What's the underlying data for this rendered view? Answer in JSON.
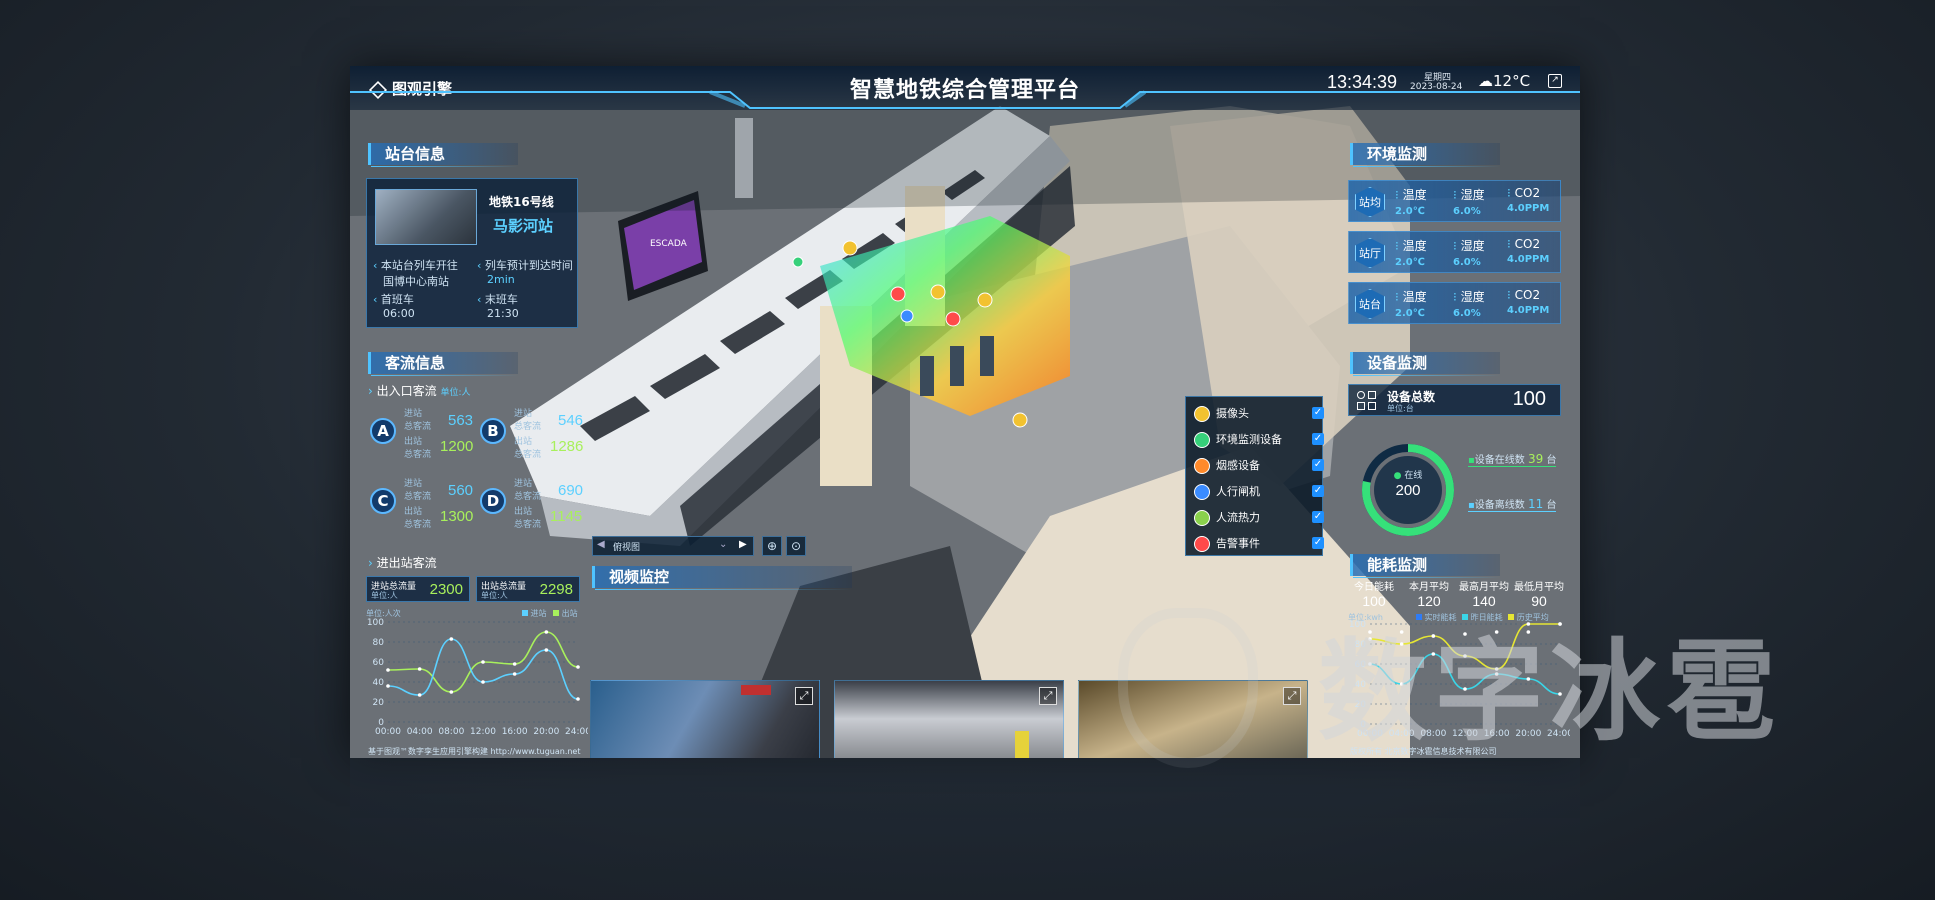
{
  "header": {
    "logo": "图观引擎",
    "title": "智慧地铁综合管理平台",
    "time": "13:34:39",
    "weekday": "星期四",
    "date": "2023-08-24",
    "weather": "12°C"
  },
  "station_info": {
    "title": "站台信息",
    "line": "地铁16号线",
    "station": "马影河站",
    "dir_label": "本站台列车开往",
    "dir_value": "国博中心南站",
    "eta_label": "列车预计到达时间",
    "eta_value": "2min",
    "first_label": "首班车",
    "first_value": "06:00",
    "last_label": "末班车",
    "last_value": "21:30"
  },
  "passenger": {
    "title": "客流信息",
    "gate_title": "出入口客流",
    "unit": "单位:人",
    "in_label": "进站",
    "out_label": "出站",
    "total_label": "总客流",
    "gates": [
      {
        "id": "A",
        "in": "563",
        "out": "1200"
      },
      {
        "id": "B",
        "in": "546",
        "out": "1286"
      },
      {
        "id": "C",
        "in": "560",
        "out": "1300"
      },
      {
        "id": "D",
        "in": "690",
        "out": "1145"
      }
    ],
    "flow_title": "进出站客流",
    "in_total_label": "进站总流量",
    "in_total": "2300",
    "out_total_label": "出站总流量",
    "out_total": "2298",
    "box_unit": "单位:人"
  },
  "flow_chart": {
    "unit": "单位:人次",
    "legend_in": "进站",
    "legend_out": "出站"
  },
  "chart_data": [
    {
      "type": "line",
      "title": "",
      "ylabel": "单位:人次",
      "x": [
        "00:00",
        "04:00",
        "08:00",
        "12:00",
        "16:00",
        "20:00",
        "24:00"
      ],
      "ylim": [
        0,
        100
      ],
      "yticks": [
        0,
        20,
        40,
        60,
        80,
        100
      ],
      "series": [
        {
          "name": "进站",
          "color": "#a8f05c",
          "values": [
            52,
            53,
            30,
            60,
            58,
            90,
            55
          ]
        },
        {
          "name": "出站",
          "color": "#5cd0ff",
          "values": [
            36,
            27,
            83,
            40,
            48,
            72,
            23
          ]
        }
      ]
    },
    {
      "type": "line",
      "title": "",
      "ylabel": "单位:kwh",
      "x": [
        "00:00",
        "04:00",
        "08:00",
        "12:00",
        "16:00",
        "20:00",
        "24:00"
      ],
      "ylim": [
        0,
        100
      ],
      "yticks": [
        0,
        20,
        40,
        60,
        80,
        100
      ],
      "series": [
        {
          "name": "实时能耗",
          "color": "#2f7cf6",
          "values": [
            92,
            92,
            88,
            90,
            92,
            92,
            100
          ]
        },
        {
          "name": "昨日能耗",
          "color": "#3ad6e8",
          "values": [
            60,
            40,
            70,
            35,
            50,
            45,
            30
          ]
        },
        {
          "name": "历史平均",
          "color": "#e6e633",
          "values": [
            85,
            80,
            88,
            68,
            55,
            100,
            100
          ]
        }
      ]
    }
  ],
  "video": {
    "title": "视频监控",
    "view_label": "俯视图"
  },
  "layers": [
    {
      "label": "摄像头",
      "icon": "camera-icon",
      "color": "#f2c230"
    },
    {
      "label": "环境监测设备",
      "icon": "env-sensor-icon",
      "color": "#36d07a"
    },
    {
      "label": "烟感设备",
      "icon": "smoke-sensor-icon",
      "color": "#ff8a2b"
    },
    {
      "label": "人行闸机",
      "icon": "gate-icon",
      "color": "#3b8cff"
    },
    {
      "label": "人流热力",
      "icon": "heatmap-icon",
      "color": "#8ad14c"
    },
    {
      "label": "告警事件",
      "icon": "alarm-icon",
      "color": "#ff4a4a"
    }
  ],
  "env": {
    "title": "环境监测",
    "rows": [
      {
        "badge": "站均",
        "temp_label": "温度",
        "temp": "2.0℃",
        "hum_label": "湿度",
        "hum": "6.0%",
        "co2_label": "CO2",
        "co2": "4.0PPM"
      },
      {
        "badge": "站厅",
        "temp_label": "温度",
        "temp": "2.0℃",
        "hum_label": "湿度",
        "hum": "6.0%",
        "co2_label": "CO2",
        "co2": "4.0PPM"
      },
      {
        "badge": "站台",
        "temp_label": "温度",
        "temp": "2.0℃",
        "hum_label": "湿度",
        "hum": "6.0%",
        "co2_label": "CO2",
        "co2": "4.0PPM"
      }
    ]
  },
  "device": {
    "title": "设备监测",
    "total_label": "设备总数",
    "unit": "单位:台",
    "total": "100",
    "ring_label": "在线",
    "ring_value": "200",
    "online_label": "设备在线数",
    "online_value": "39",
    "offline_label": "设备离线数",
    "offline_value": "11",
    "unit_tai": "台",
    "online_ratio": 0.78
  },
  "energy": {
    "title": "能耗监测",
    "stats": [
      {
        "label": "今日能耗",
        "value": "100"
      },
      {
        "label": "本月平均",
        "value": "120"
      },
      {
        "label": "最高月平均",
        "value": "140"
      },
      {
        "label": "最低月平均",
        "value": "90"
      }
    ],
    "unit": "单位:kwh",
    "legend": [
      "实时能耗",
      "昨日能耗",
      "历史平均"
    ]
  },
  "footer": {
    "left": "基于图观™数字孪生应用引擎构建 http://www.tuguan.net",
    "right": "版权所有 北京数字冰雹信息技术有限公司"
  },
  "watermark": "数字冰雹"
}
